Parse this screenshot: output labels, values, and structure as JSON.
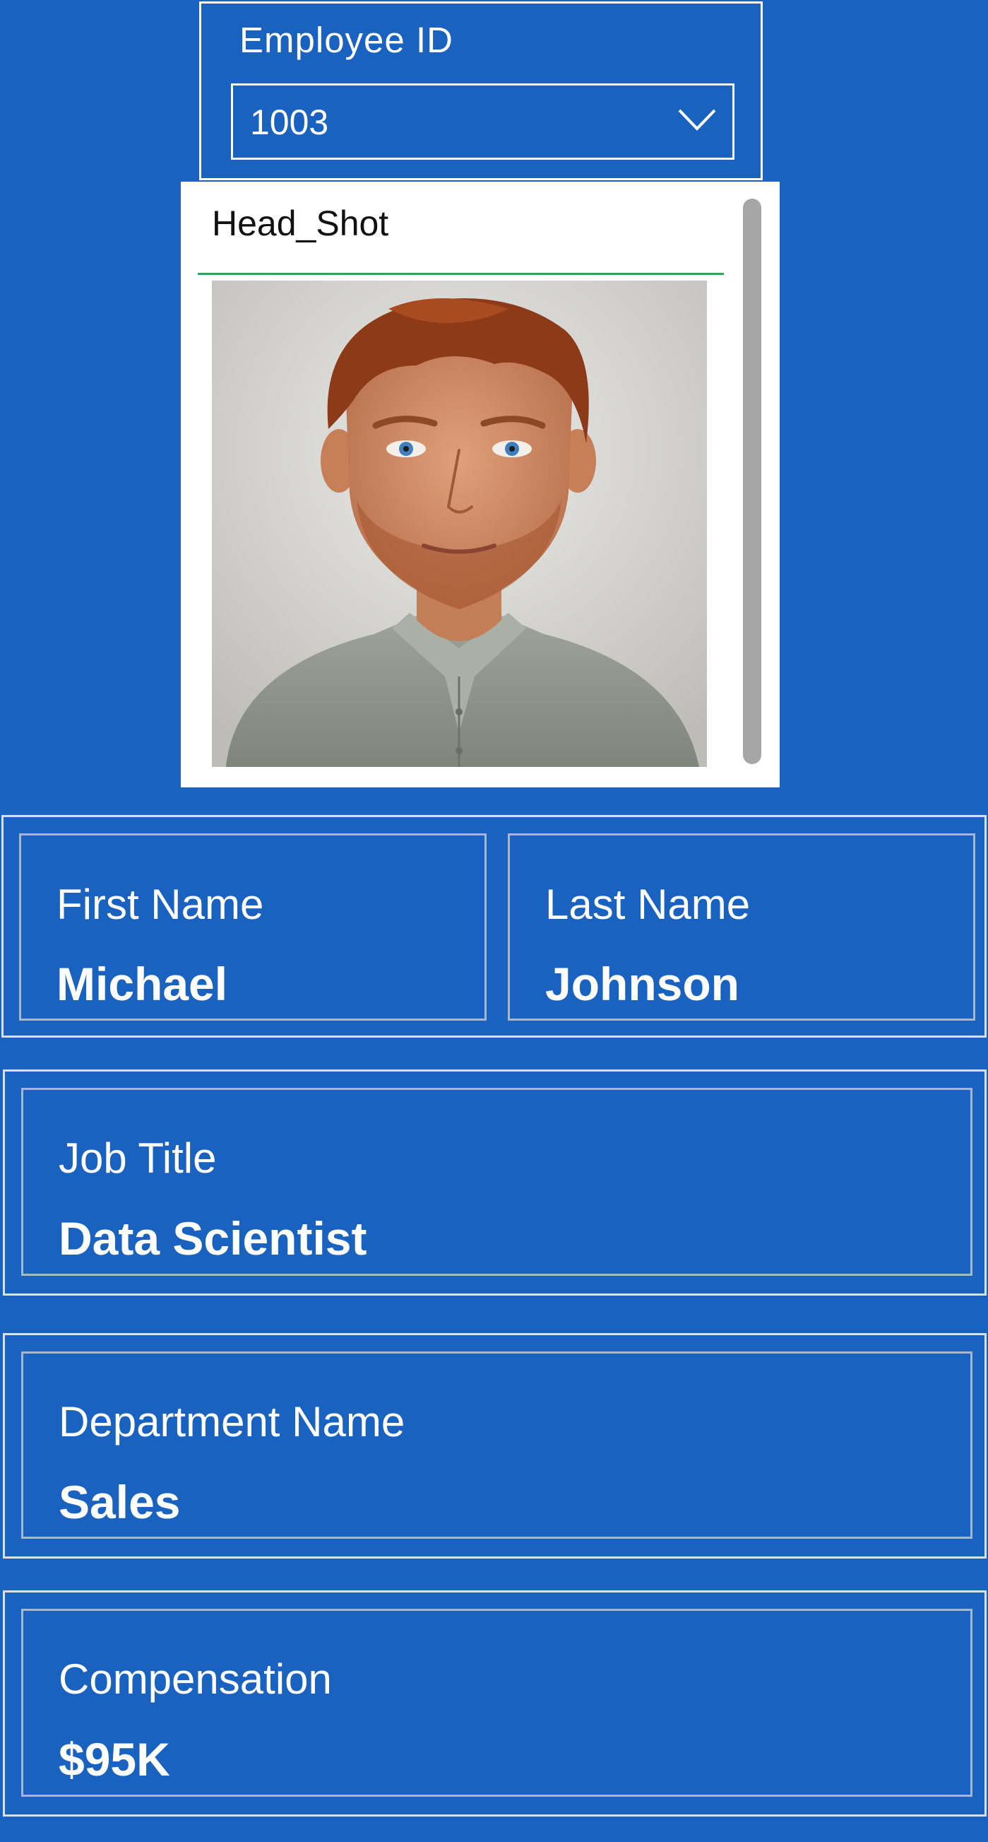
{
  "colors": {
    "background": "#1a62c0",
    "panel": "#ffffff",
    "accent_underline": "#3aa05c",
    "scrollbar": "#a6a6a6"
  },
  "slicer": {
    "title": "Employee ID",
    "selected_value": "1003",
    "icon": "chevron-down-icon"
  },
  "headshot": {
    "label": "Head_Shot",
    "image_alt": "Head shot photo of employee"
  },
  "cards": {
    "first_name": {
      "label": "First Name",
      "value": "Michael"
    },
    "last_name": {
      "label": "Last Name",
      "value": "Johnson"
    },
    "job_title": {
      "label": "Job Title",
      "value": "Data Scientist"
    },
    "department": {
      "label": "Department Name",
      "value": "Sales"
    },
    "compensation": {
      "label": "Compensation",
      "value": "$95K"
    }
  }
}
